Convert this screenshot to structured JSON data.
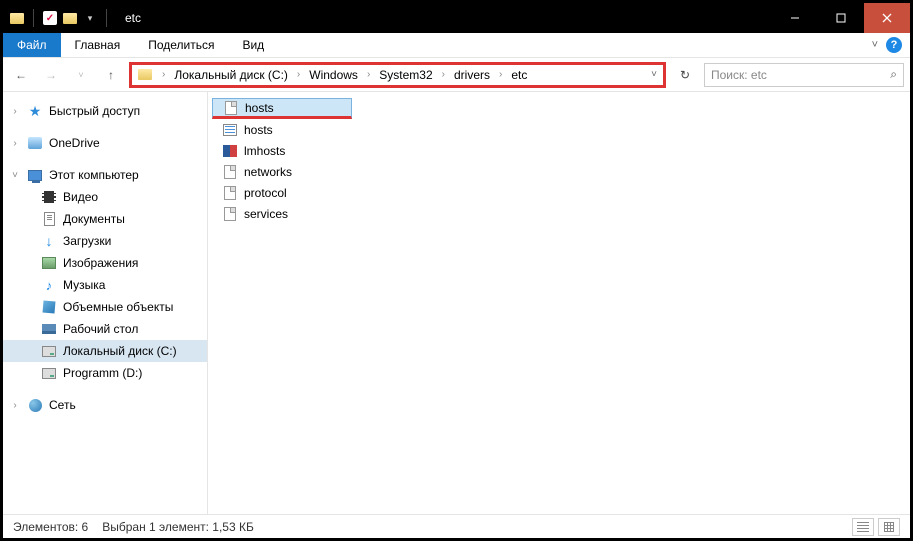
{
  "title": "etc",
  "menu": {
    "file": "Файл",
    "home": "Главная",
    "share": "Поделиться",
    "view": "Вид"
  },
  "breadcrumb": [
    "Локальный диск (C:)",
    "Windows",
    "System32",
    "drivers",
    "etc"
  ],
  "search_placeholder": "Поиск: etc",
  "sidebar": {
    "quick_access": "Быстрый доступ",
    "onedrive": "OneDrive",
    "this_pc": "Этот компьютер",
    "videos": "Видео",
    "documents": "Документы",
    "downloads": "Загрузки",
    "pictures": "Изображения",
    "music": "Музыка",
    "objects3d": "Объемные объекты",
    "desktop": "Рабочий стол",
    "local_disk_c": "Локальный диск (C:)",
    "programm_d": "Programm (D:)",
    "network": "Сеть"
  },
  "files": [
    {
      "name": "hosts",
      "icon": "doc",
      "selected": true,
      "underlined": true
    },
    {
      "name": "hosts",
      "icon": "hosts",
      "selected": false
    },
    {
      "name": "lmhosts",
      "icon": "lm",
      "selected": false
    },
    {
      "name": "networks",
      "icon": "doc",
      "selected": false
    },
    {
      "name": "protocol",
      "icon": "doc",
      "selected": false
    },
    {
      "name": "services",
      "icon": "doc",
      "selected": false
    }
  ],
  "status": {
    "count": "Элементов: 6",
    "selection": "Выбран 1 элемент: 1,53 КБ"
  }
}
